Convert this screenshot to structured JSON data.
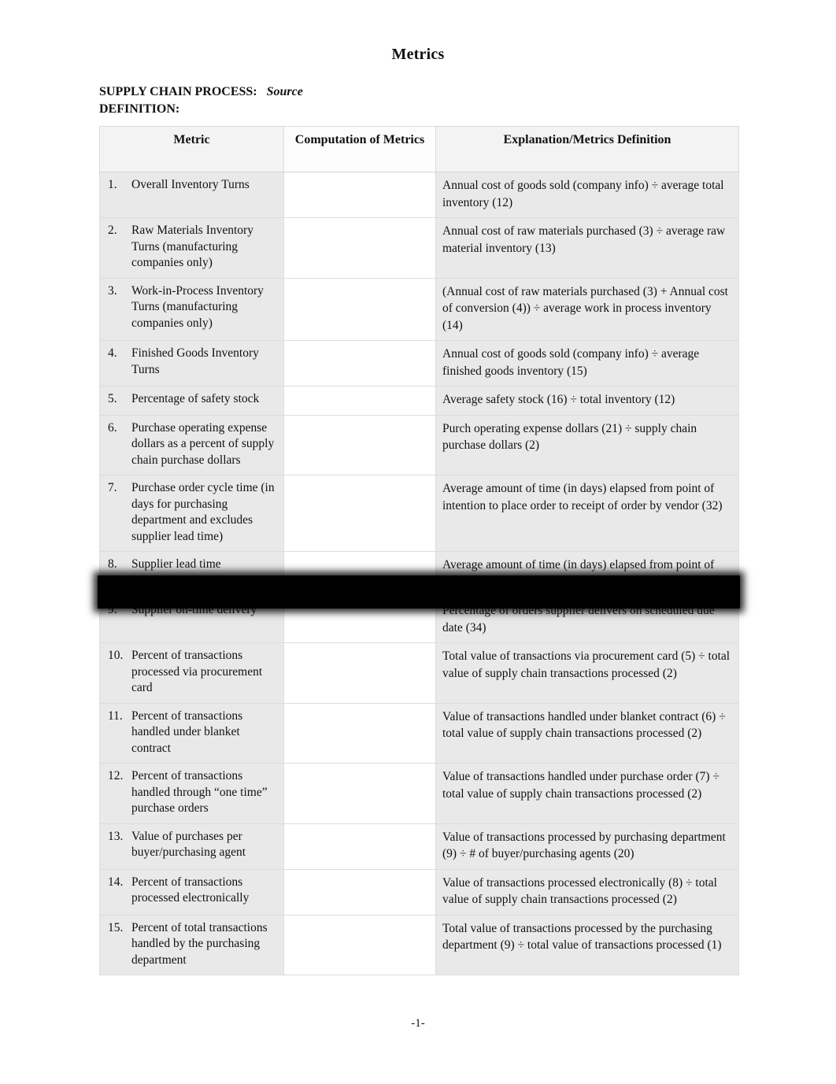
{
  "document": {
    "title": "Metrics",
    "page_label": "-1-"
  },
  "heading": {
    "process_label": "SUPPLY CHAIN PROCESS:",
    "process_value": "Source",
    "definition_label": "DEFINITION:"
  },
  "table": {
    "columns": [
      "Metric",
      "Computation of Metrics",
      "Explanation/Metrics Definition"
    ],
    "rows": [
      {
        "num": "1.",
        "metric": "Overall Inventory Turns",
        "computation": "",
        "explanation": "Annual cost of goods sold (company info) ÷ average total inventory (12)"
      },
      {
        "num": "2.",
        "metric": "Raw Materials Inventory Turns (manufacturing companies only)",
        "computation": "",
        "explanation": "Annual cost of raw materials purchased (3) ÷ average raw material inventory (13)"
      },
      {
        "num": "3.",
        "metric": "Work-in-Process Inventory Turns (manufacturing companies only)",
        "computation": "",
        "explanation": "(Annual cost of raw materials purchased (3) + Annual cost of conversion (4)) ÷ average work in process inventory (14)"
      },
      {
        "num": "4.",
        "metric": "Finished Goods Inventory Turns",
        "computation": "",
        "explanation": "Annual cost of goods sold (company info)  ÷ average finished goods inventory (15)"
      },
      {
        "num": "5.",
        "metric": "Percentage of safety stock",
        "computation": "",
        "explanation": "Average safety stock (16)  ÷ total inventory (12)"
      },
      {
        "num": "6.",
        "metric": "Purchase operating expense dollars as a percent of  supply chain purchase dollars",
        "computation": "",
        "explanation": "Purch operating expense dollars (21) ÷ supply chain purchase dollars (2)"
      },
      {
        "num": "7.",
        "metric": "Purchase order cycle time (in days for purchasing department and excludes supplier lead time)",
        "computation": "",
        "explanation": "Average amount of time (in days) elapsed from point of intention to place order to receipt of order by vendor (32)"
      },
      {
        "num": "8.",
        "metric": "Supplier lead time",
        "computation": "",
        "explanation": "Average amount of time (in days) elapsed from point of order to delivery (32)"
      },
      {
        "num": "9.",
        "metric": "Supplier on-time delivery",
        "computation": "",
        "explanation": "Percentage of orders supplier delivers on scheduled due date (34)"
      },
      {
        "num": "10.",
        "metric": "Percent of transactions processed via procurement card",
        "computation": "",
        "explanation": "Total value of transactions via procurement card (5) ÷ total value of supply chain transactions processed (2)"
      },
      {
        "num": "11.",
        "metric": "Percent of transactions handled under blanket contract",
        "computation": "",
        "explanation": "Value of transactions handled under blanket contract (6) ÷ total value of supply chain transactions processed (2)"
      },
      {
        "num": "12.",
        "metric": "Percent of transactions handled through “one time” purchase orders",
        "computation": "",
        "explanation": "Value of transactions handled under purchase order (7) ÷ total value of supply chain transactions processed (2)"
      },
      {
        "num": "13.",
        "metric": "Value of purchases per buyer/purchasing agent",
        "computation": "",
        "explanation": "Value of transactions processed by purchasing department (9) ÷ #  of buyer/purchasing agents (20)"
      },
      {
        "num": "14.",
        "metric": "Percent of transactions processed electronically",
        "computation": "",
        "explanation": "Value of transactions processed electronically (8) ÷ total value of supply chain transactions processed (2)"
      },
      {
        "num": "15.",
        "metric": "Percent of total transactions handled by the purchasing department",
        "computation": "",
        "explanation": "Total value of transactions processed by the purchasing department (9) ÷ total value of transactions processed (1)"
      }
    ]
  },
  "redaction": {
    "label": "redaction-bar",
    "color": "#000000"
  }
}
